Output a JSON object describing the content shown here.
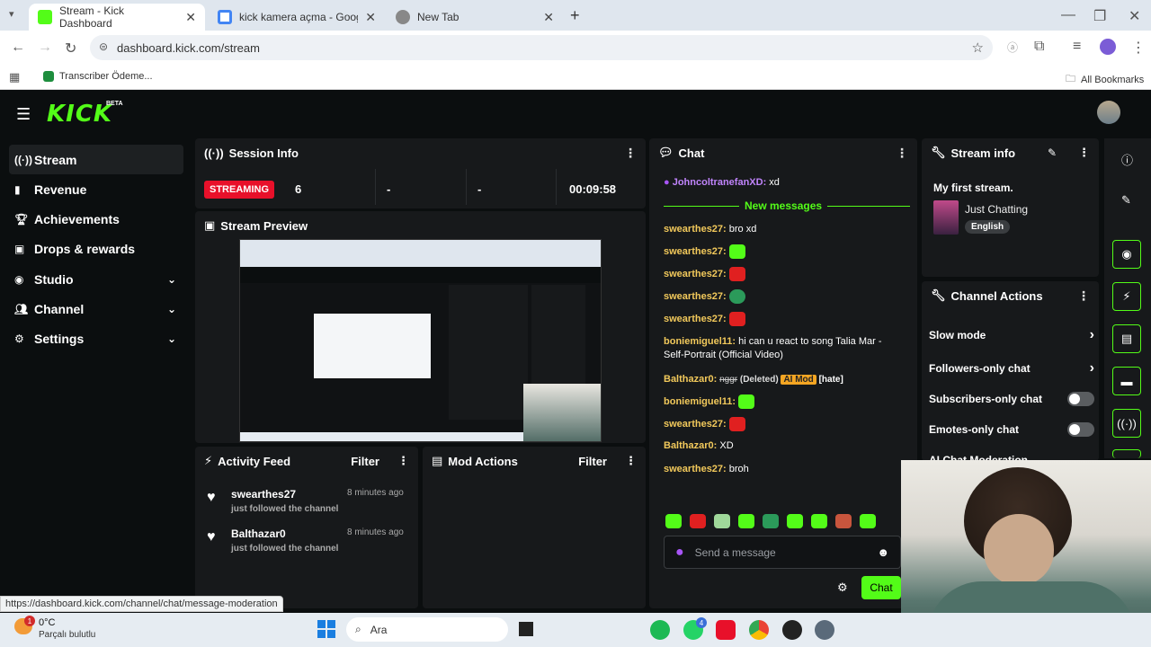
{
  "browser": {
    "tabs": [
      {
        "label": "Stream - Kick Dashboard",
        "active": true
      },
      {
        "label": "kick kamera açma - Google'da A"
      },
      {
        "label": "New Tab"
      }
    ],
    "new_tab": "+",
    "url": "dashboard.kick.com/stream",
    "bookmarks": [
      {
        "label": "Transcriber Ödeme..."
      }
    ],
    "all_bookmarks": "All Bookmarks",
    "status_url": "https://dashboard.kick.com/channel/chat/message-moderation"
  },
  "kick": {
    "logo": "KICK",
    "beta": "BETA",
    "accent": "#53fc18"
  },
  "sidebar": {
    "items": [
      {
        "label": "Stream",
        "icon": "signal-icon"
      },
      {
        "label": "Revenue",
        "icon": "chart-icon"
      },
      {
        "label": "Achievements",
        "icon": "trophy-icon"
      },
      {
        "label": "Drops & rewards",
        "icon": "gift-icon"
      },
      {
        "label": "Studio",
        "icon": "camera-icon"
      },
      {
        "label": "Channel",
        "icon": "users-icon"
      },
      {
        "label": "Settings",
        "icon": "gear-icon"
      }
    ]
  },
  "session": {
    "title": "Session Info",
    "status": "STREAMING",
    "viewers": "6",
    "stat2": "-",
    "stat3": "-",
    "time": "00:09:58"
  },
  "preview": {
    "title": "Stream Preview"
  },
  "activity": {
    "title": "Activity Feed",
    "filter": "Filter",
    "items": [
      {
        "user": "swearthes27",
        "time": "8 minutes ago",
        "text": "just followed the channel"
      },
      {
        "user": "Balthazar0",
        "time": "8 minutes ago",
        "text": "just followed the channel"
      }
    ]
  },
  "mod": {
    "title": "Mod Actions",
    "filter": "Filter"
  },
  "chat": {
    "title": "Chat",
    "pinned_user": "JohncoltranefanXD:",
    "pinned_text": "xd",
    "new_messages": "New messages",
    "messages": [
      {
        "user": "swearthes27:",
        "text": "bro xd"
      },
      {
        "user": "swearthes27:"
      },
      {
        "user": "swearthes27:"
      },
      {
        "user": "swearthes27:"
      },
      {
        "user": "swearthes27:"
      },
      {
        "user": "boniemiguel11:",
        "text": "hi can u react to song Talia Mar - Self-Portrait (Official Video)"
      },
      {
        "user": "Balthazar0:",
        "text": "nggr",
        "deleted": "(Deleted)",
        "badge": "AI Mod",
        "tag": "[hate]"
      },
      {
        "user": "boniemiguel11:"
      },
      {
        "user": "swearthes27:"
      },
      {
        "user": "Balthazar0:",
        "text": "XD"
      },
      {
        "user": "swearthes27:",
        "text": "broh"
      }
    ],
    "placeholder": "Send a message",
    "send": "Chat"
  },
  "stream_info": {
    "title": "Stream info",
    "stream_title": "My first stream.",
    "category": "Just Chatting",
    "language": "English"
  },
  "channel_actions": {
    "title": "Channel Actions",
    "items": [
      {
        "label": "Slow mode"
      },
      {
        "label": "Followers-only chat"
      },
      {
        "label": "Subscribers-only chat"
      },
      {
        "label": "Emotes-only chat"
      },
      {
        "label": "AI Chat Moderation"
      }
    ]
  },
  "taskbar": {
    "weather_temp": "0°C",
    "weather_text": "Parçalı bulutlu",
    "weather_badge": "1",
    "search": "Ara",
    "whatsapp_badge": "4"
  }
}
